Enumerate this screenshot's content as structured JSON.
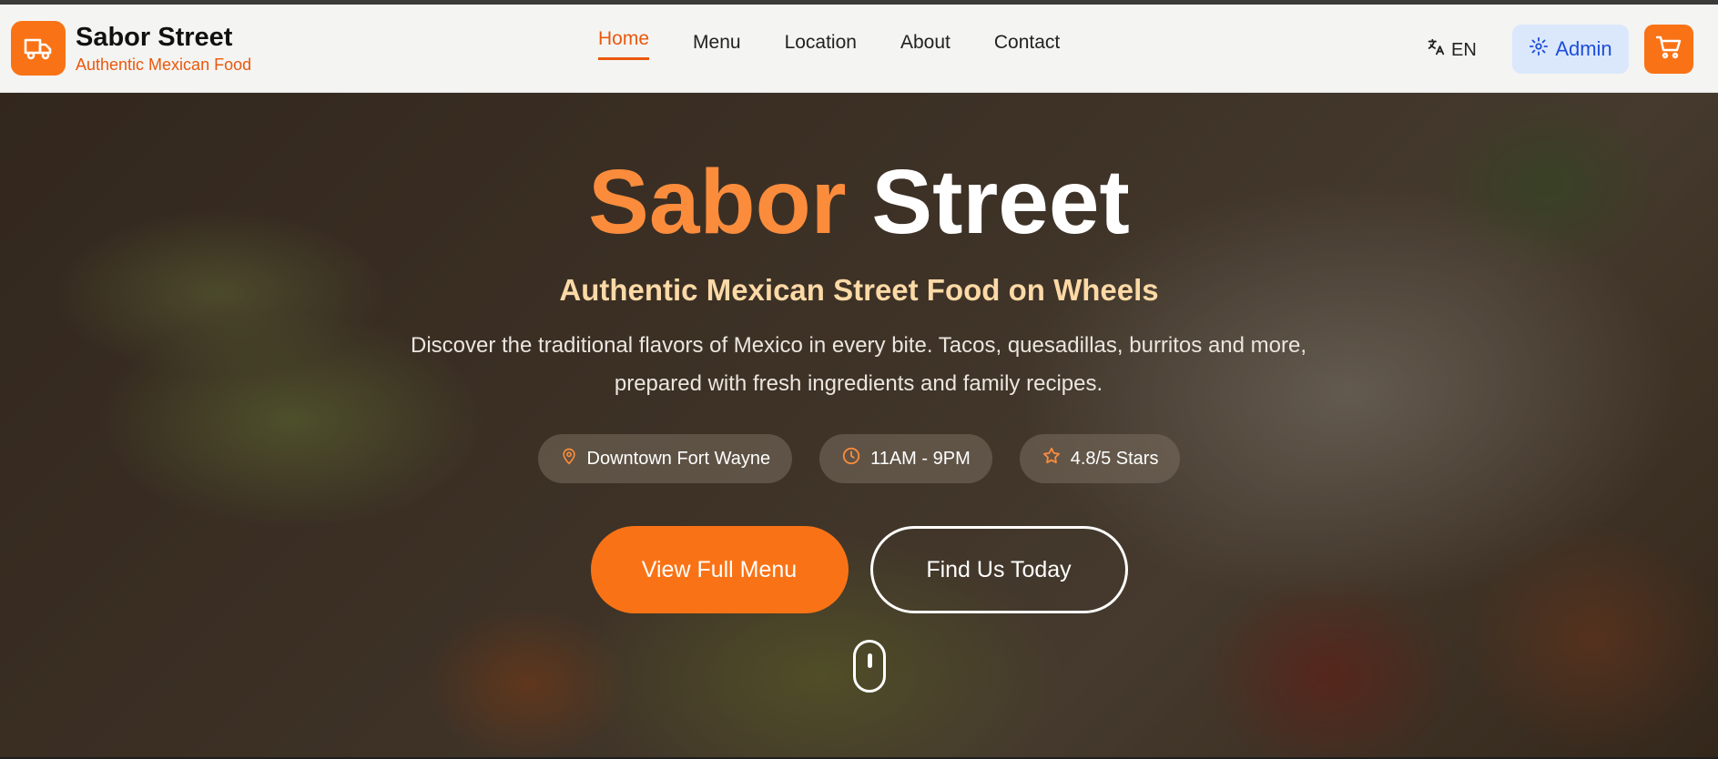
{
  "brand": {
    "name": "Sabor Street",
    "tagline": "Authentic Mexican Food"
  },
  "nav": {
    "items": [
      {
        "label": "Home",
        "active": true
      },
      {
        "label": "Menu",
        "active": false
      },
      {
        "label": "Location",
        "active": false
      },
      {
        "label": "About",
        "active": false
      },
      {
        "label": "Contact",
        "active": false
      }
    ]
  },
  "header_actions": {
    "language": "EN",
    "admin_label": "Admin"
  },
  "hero": {
    "title_part1": "Sabor",
    "title_part2": "Street",
    "subtitle": "Authentic Mexican Street Food on Wheels",
    "description": "Discover the traditional flavors of Mexico in every bite. Tacos, quesadillas, burritos and more, prepared with fresh ingredients and family recipes.",
    "chips": [
      {
        "icon": "map-pin-icon",
        "label": "Downtown Fort Wayne"
      },
      {
        "icon": "clock-icon",
        "label": "11AM - 9PM"
      },
      {
        "icon": "star-icon",
        "label": "4.8/5 Stars"
      }
    ],
    "primary_button": "View Full Menu",
    "secondary_button": "Find Us Today"
  },
  "colors": {
    "accent": "#f97316",
    "accent_text": "#ea580c",
    "admin_bg": "#dbe8fb",
    "admin_text": "#1d4ed8"
  }
}
